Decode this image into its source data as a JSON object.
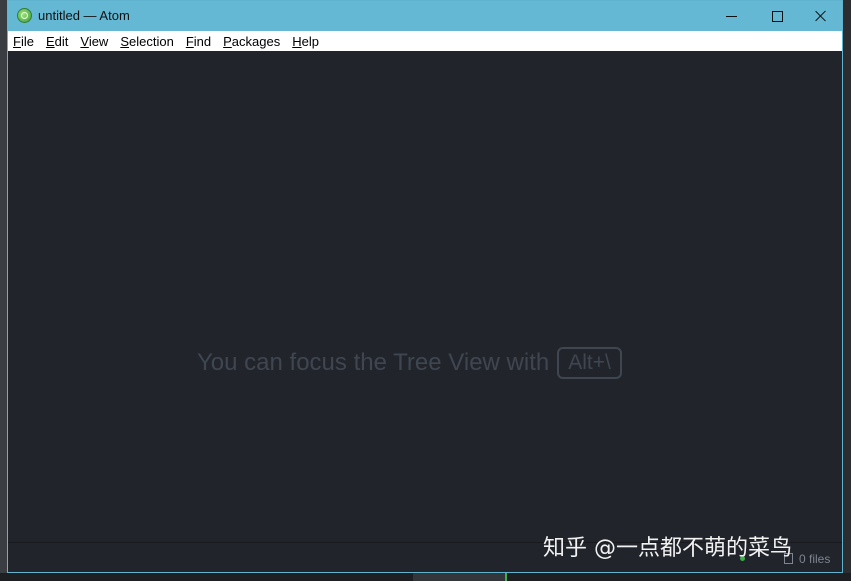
{
  "window": {
    "title": "untitled — Atom",
    "controls": {
      "minimize": "minimize-icon",
      "maximize": "maximize-icon",
      "close": "close-icon"
    }
  },
  "menubar": {
    "items": [
      {
        "key": "F",
        "rest": "ile"
      },
      {
        "key": "E",
        "rest": "dit"
      },
      {
        "key": "V",
        "rest": "iew"
      },
      {
        "key": "S",
        "rest": "election"
      },
      {
        "key": "F",
        "rest": "ind"
      },
      {
        "key": "P",
        "rest": "ackages"
      },
      {
        "key": "H",
        "rest": "elp"
      }
    ]
  },
  "editor": {
    "hint": "You can focus the Tree View with",
    "shortcut": "Alt+\\"
  },
  "statusbar": {
    "files": "0 files"
  },
  "watermark": "知乎 @一点都不萌的菜鸟",
  "colors": {
    "titlebar": "#65b8d3",
    "editor_bg": "#21252b",
    "hint_text": "#3f4650",
    "status_dot": "#3fb04d"
  }
}
